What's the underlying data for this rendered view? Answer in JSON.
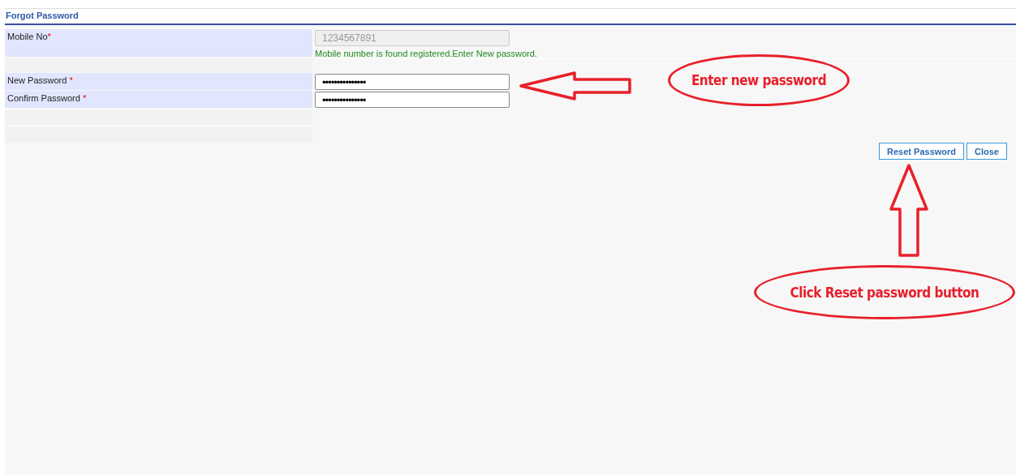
{
  "panel": {
    "title": "Forgot Password"
  },
  "fields": [
    {
      "label": "Mobile No",
      "required": "*",
      "kind": "text",
      "value": "1234567891",
      "disabled": true,
      "message": "Mobile number is found registered.Enter New password."
    },
    {
      "label": "New Password ",
      "required": "*",
      "kind": "password",
      "value": "•••••••••••••••",
      "disabled": false
    },
    {
      "label": "Confirm Password ",
      "required": "*",
      "kind": "password",
      "value": "•••••••••••••••",
      "disabled": false
    }
  ],
  "buttons": [
    "Reset Password",
    "Close"
  ],
  "annotations": [
    {
      "text": "Enter new password",
      "kind": "left"
    },
    {
      "text": "Click Reset password button",
      "kind": "up"
    }
  ]
}
